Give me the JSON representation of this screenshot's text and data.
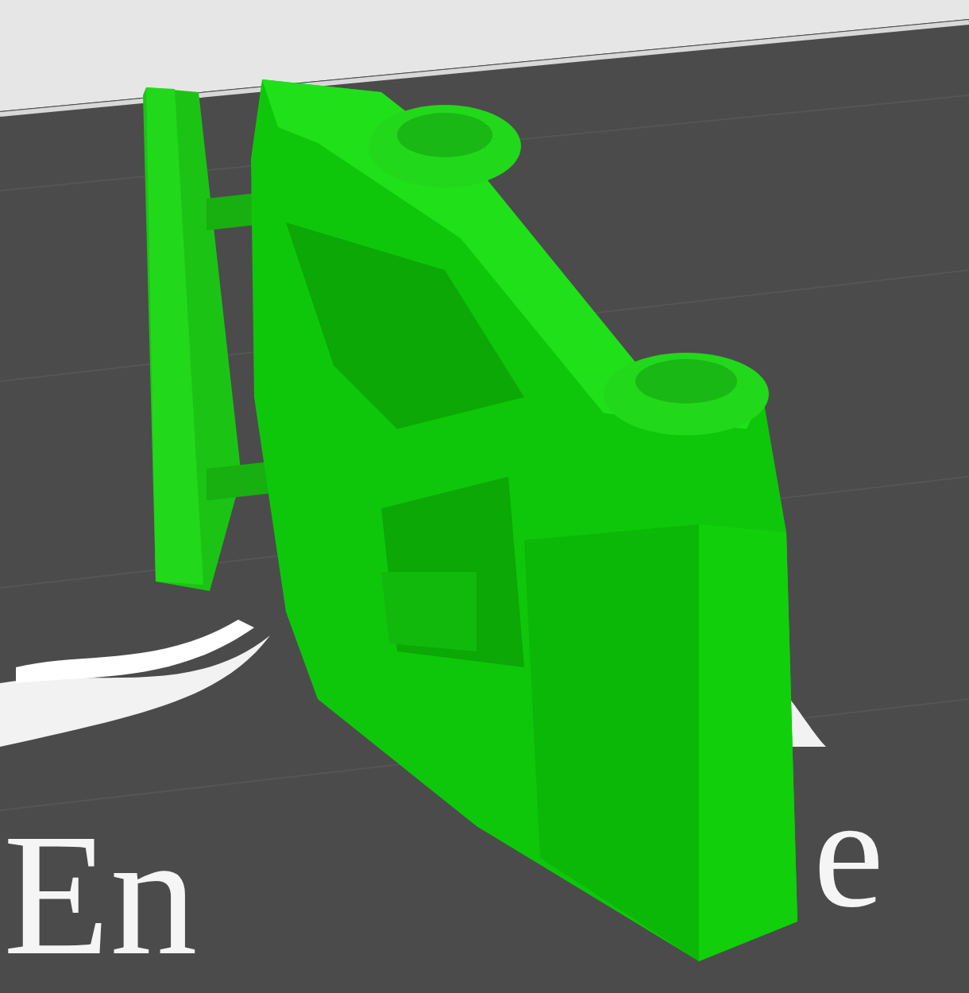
{
  "viewport": {
    "bed_logo": [
      {
        "text": "En",
        "kind": "left"
      },
      {
        "text": "e",
        "kind": "right"
      }
    ]
  }
}
